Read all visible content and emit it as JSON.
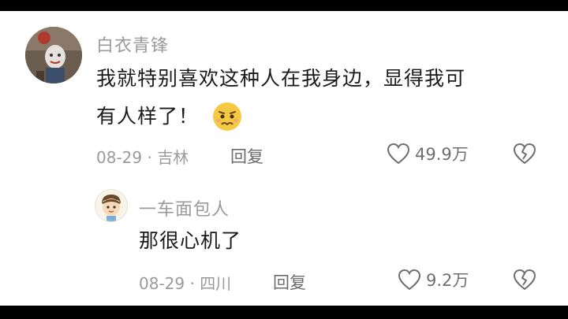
{
  "comments": [
    {
      "username": "白衣青锋",
      "text_line1": "我就特别喜欢这种人在我身边，显得我可",
      "text_line2": "有人样了！",
      "date_location": "08-29 · 吉林",
      "reply_label": "回复",
      "likes": "49.9万",
      "emoji_icon": "nervous-face-emoji",
      "avatar_icon": "clown-figure-avatar"
    },
    {
      "username": "一车面包人",
      "text": "那很心机了",
      "date_location": "08-29 · 四川",
      "reply_label": "回复",
      "likes": "9.2万",
      "avatar_icon": "cartoon-boy-avatar"
    }
  ],
  "colors": {
    "background": "#ffffff",
    "frame": "#000000",
    "meta_text": "#9a9a9a",
    "body_text": "#1a1a1a"
  }
}
